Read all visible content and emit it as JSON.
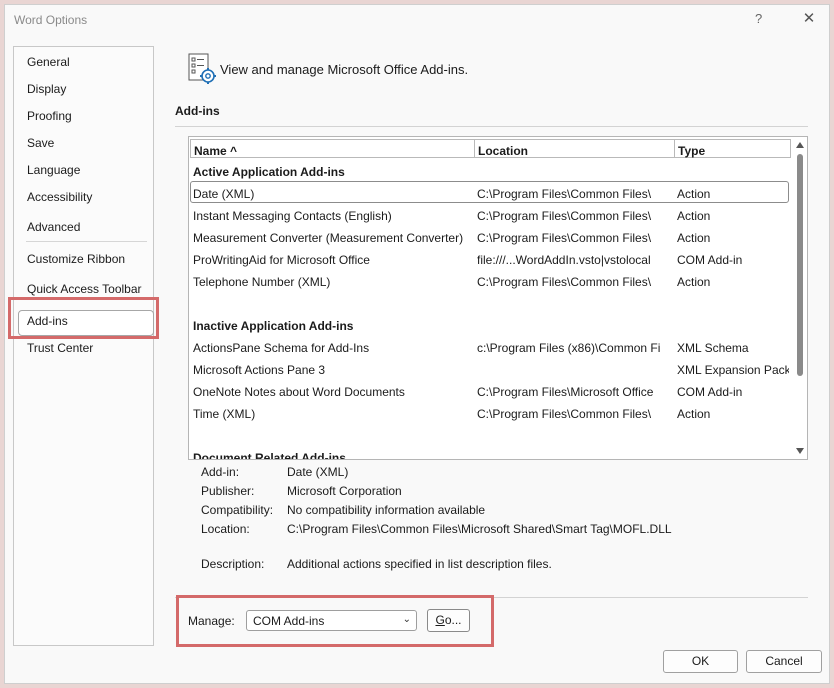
{
  "window": {
    "title": "Word Options",
    "help": "?",
    "close": "✕"
  },
  "nav": {
    "items": [
      "General",
      "Display",
      "Proofing",
      "Save",
      "Language",
      "Accessibility",
      "Advanced",
      "Customize Ribbon",
      "Quick Access Toolbar",
      "Add-ins",
      "Trust Center"
    ],
    "selected": "Add-ins"
  },
  "header": {
    "text": "View and manage Microsoft Office Add-ins.",
    "icon": "addins-gear-icon"
  },
  "section": {
    "title": "Add-ins"
  },
  "table": {
    "columns": [
      "Name ^",
      "Location",
      "Type"
    ],
    "groups": [
      {
        "label": "Active Application Add-ins",
        "rows": [
          [
            "Date (XML)",
            "C:\\Program Files\\Common Files\\",
            "Action"
          ],
          [
            "Instant Messaging Contacts (English)",
            "C:\\Program Files\\Common Files\\",
            "Action"
          ],
          [
            "Measurement Converter (Measurement Converter)",
            "C:\\Program Files\\Common Files\\",
            "Action"
          ],
          [
            "ProWritingAid for Microsoft Office",
            "file:///...WordAddIn.vsto|vstolocal",
            "COM Add-in"
          ],
          [
            "Telephone Number (XML)",
            "C:\\Program Files\\Common Files\\",
            "Action"
          ]
        ]
      },
      {
        "label": "Inactive Application Add-ins",
        "rows": [
          [
            "ActionsPane Schema for Add-Ins",
            "c:\\Program Files (x86)\\Common Fi",
            "XML Schema"
          ],
          [
            "Microsoft Actions Pane 3",
            "",
            "XML Expansion Pack"
          ],
          [
            "OneNote Notes about Word Documents",
            "C:\\Program Files\\Microsoft Office",
            "COM Add-in"
          ],
          [
            "Time (XML)",
            "C:\\Program Files\\Common Files\\",
            "Action"
          ]
        ]
      },
      {
        "label": "Document Related Add-ins",
        "rows": []
      }
    ]
  },
  "details": {
    "addin_label": "Add-in:",
    "addin_value": "Date (XML)",
    "publisher_label": "Publisher:",
    "publisher_value": "Microsoft Corporation",
    "compat_label": "Compatibility:",
    "compat_value": "No compatibility information available",
    "location_label": "Location:",
    "location_value": "C:\\Program Files\\Common Files\\Microsoft Shared\\Smart Tag\\MOFL.DLL",
    "description_label": "Description:",
    "description_value": "Additional actions specified in list description files."
  },
  "manage": {
    "label_pre": "Mana",
    "label_u": "g",
    "label_post": "e:",
    "select_value": "COM Add-ins",
    "go_pre": "",
    "go_u": "G",
    "go_post": "o..."
  },
  "buttons": {
    "ok": "OK",
    "cancel": "Cancel"
  },
  "colors": {
    "highlight": "#d46a6a",
    "background": "#e9d5d3"
  }
}
